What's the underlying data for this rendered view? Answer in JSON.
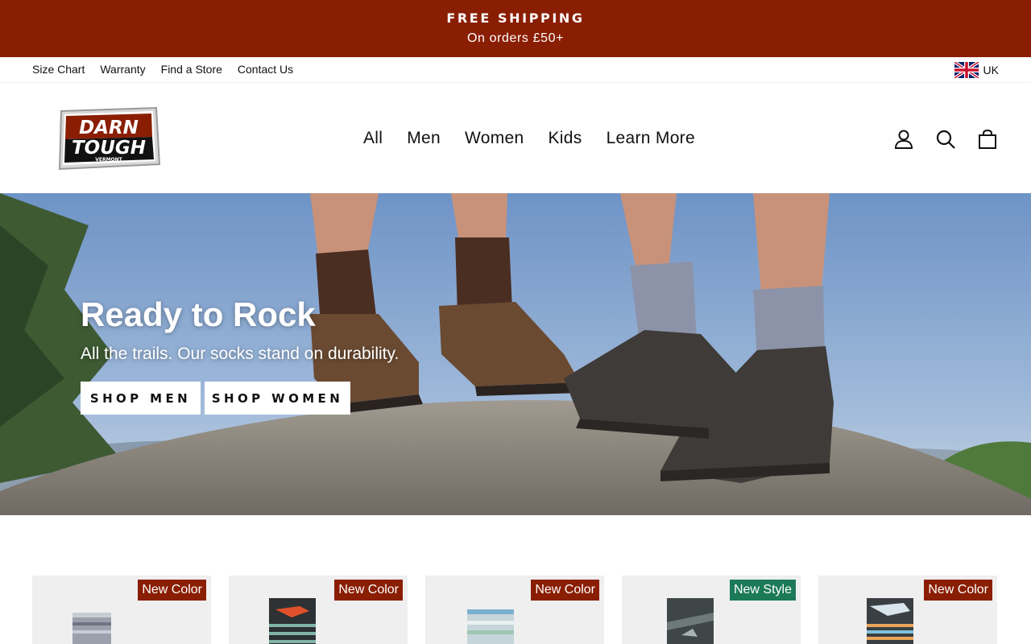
{
  "announcement": {
    "title": "FREE SHIPPING",
    "subtitle": "On orders £50+",
    "background": "#8a1e03"
  },
  "utility_nav": {
    "links": [
      "Size Chart",
      "Warranty",
      "Find a Store",
      "Contact Us"
    ],
    "locale": "UK",
    "locale_icon": "uk-flag-icon"
  },
  "header": {
    "logo": {
      "line1": "DARN",
      "line2": "TOUGH",
      "line3": "VERMONT"
    },
    "nav": [
      "All",
      "Men",
      "Women",
      "Kids",
      "Learn More"
    ],
    "icons": [
      "account-icon",
      "search-icon",
      "cart-icon"
    ]
  },
  "hero": {
    "title": "Ready to Rock",
    "subtitle": "All the trails. Our socks stand on durability.",
    "buttons": [
      "SHOP MEN",
      "SHOP WOMEN"
    ]
  },
  "products": [
    {
      "badge": "New Color",
      "badge_type": "color"
    },
    {
      "badge": "New Color",
      "badge_type": "color"
    },
    {
      "badge": "New Color",
      "badge_type": "color"
    },
    {
      "badge": "New Style",
      "badge_type": "style"
    },
    {
      "badge": "New Color",
      "badge_type": "color"
    }
  ],
  "colors": {
    "brand_red": "#8a1e03",
    "new_style_green": "#1c7a58",
    "card_background": "#efefef"
  }
}
